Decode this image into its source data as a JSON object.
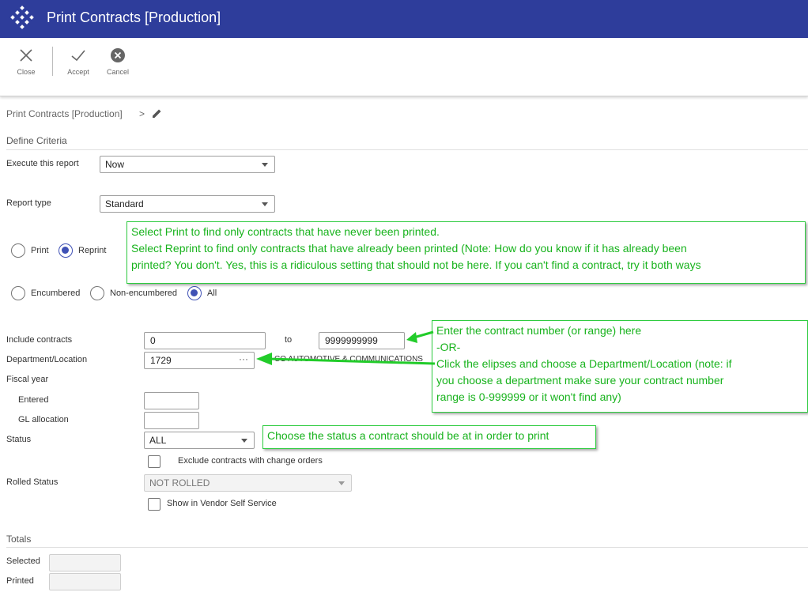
{
  "app": {
    "title": "Print Contracts [Production]"
  },
  "toolbar": {
    "close_label": "Close",
    "accept_label": "Accept",
    "cancel_label": "Cancel"
  },
  "breadcrumb": {
    "path": "Print Contracts [Production]",
    "separator": ">"
  },
  "criteria": {
    "section_title": "Define Criteria",
    "execute": {
      "label": "Execute this report",
      "value": "Now"
    },
    "report_type": {
      "label": "Report type",
      "value": "Standard"
    },
    "print_mode": {
      "options": [
        "Print",
        "Reprint"
      ],
      "selected": "Reprint"
    },
    "encumbrance": {
      "options": [
        "Encumbered",
        "Non-encumbered",
        "All"
      ],
      "selected": "All"
    },
    "include_contracts": {
      "label": "Include contracts",
      "from": "0",
      "to_label": "to",
      "to": "9999999999"
    },
    "department": {
      "label": "Department/Location",
      "value": "1729",
      "description": "CO AUTOMOTIVE & COMMUNICATIONS"
    },
    "fiscal_year": {
      "label": "Fiscal year",
      "entered_label": "Entered",
      "entered_value": "",
      "gl_label": "GL allocation",
      "gl_value": ""
    },
    "status": {
      "label": "Status",
      "value": "ALL"
    },
    "exclude_change_orders": {
      "label": "Exclude contracts with change orders",
      "checked": false
    },
    "rolled_status": {
      "label": "Rolled Status",
      "value": "NOT ROLLED"
    },
    "vendor_self_service": {
      "label": "Show in Vendor Self Service",
      "checked": false
    }
  },
  "totals": {
    "section_title": "Totals",
    "selected_label": "Selected",
    "selected_value": "",
    "printed_label": "Printed",
    "printed_value": ""
  },
  "annotations": {
    "print_note": [
      "Select Print to find only contracts that have never been printed.",
      "Select Reprint to find only contracts that have already been printed (Note: How do you know if it has already been",
      "printed? You don't. Yes, this is a ridiculous setting that should not be here. If you can't find a contract, try it both ways"
    ],
    "contract_note": [
      "Enter the contract number (or range) here",
      "-OR-",
      "Click the elipses and choose a Department/Location (note: if",
      "you choose a department make sure your contract number",
      "range is 0-999999 or it won't find any)"
    ],
    "status_note": "Choose the status a contract should be at in order to print"
  },
  "colors": {
    "header": "#2e3d9b",
    "accent": "#3f51b5",
    "annotation": "#18b31d"
  }
}
